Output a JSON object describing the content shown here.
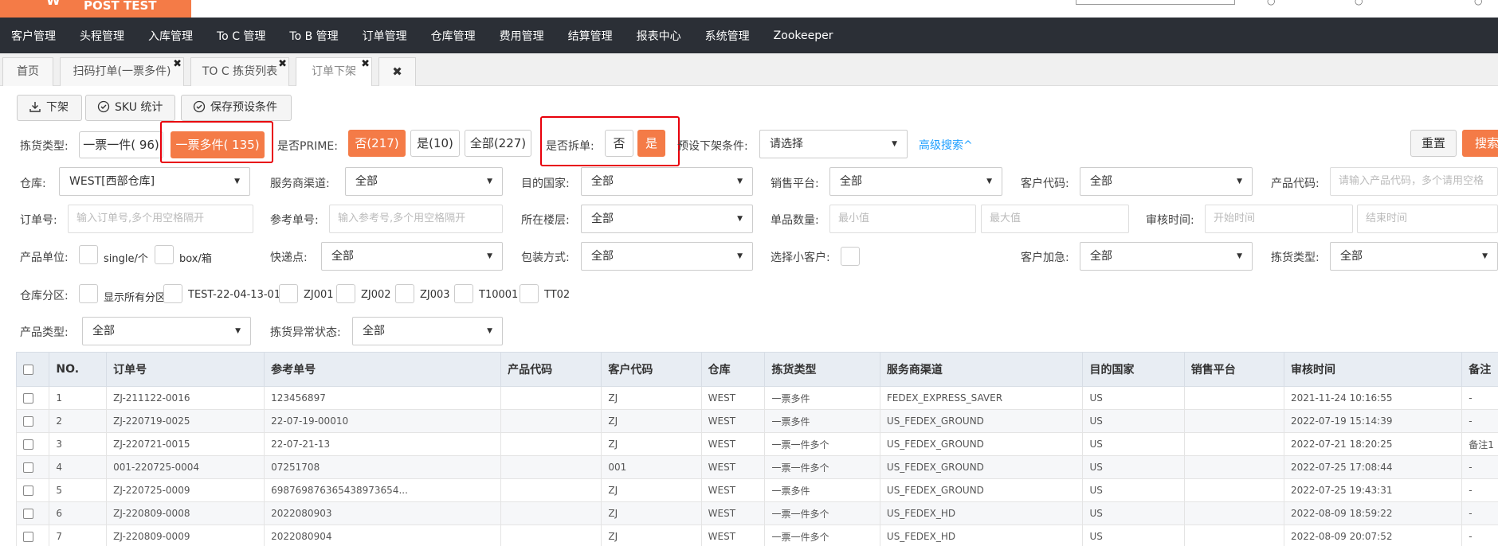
{
  "brand": {
    "logo_text": "POST TEST"
  },
  "nav": [
    "客户管理",
    "头程管理",
    "入库管理",
    "To C 管理",
    "To B 管理",
    "订单管理",
    "仓库管理",
    "费用管理",
    "结算管理",
    "报表中心",
    "系统管理",
    "Zookeeper"
  ],
  "tabs": [
    {
      "label": "首页"
    },
    {
      "label": "扫码打单(一票多件)"
    },
    {
      "label": "TO C 拣货列表"
    },
    {
      "label": "订单下架"
    }
  ],
  "toolbar": {
    "offshelf": "下架",
    "sku_stats": "SKU 统计",
    "save_preset": "保存预设条件"
  },
  "filters": {
    "pick_type_label": "拣货类型:",
    "pick_single": "一票一件( 96)",
    "pick_multi": "一票多件( 135)",
    "prime_label": "是否PRIME:",
    "prime_no": "否(217)",
    "prime_yes": "是(10)",
    "prime_all": "全部(227)",
    "split_label": "是否拆单:",
    "split_no": "否",
    "split_yes": "是",
    "preset_label": "预设下架条件:",
    "preset_value": "请选择",
    "advanced": "高级搜索^",
    "reset": "重置",
    "search": "搜索",
    "warehouse_label": "仓库:",
    "warehouse_value": "WEST[西部仓库]",
    "channel_label": "服务商渠道:",
    "channel_value": "全部",
    "dest_label": "目的国家:",
    "dest_value": "全部",
    "platform_label": "销售平台:",
    "platform_value": "全部",
    "customer_label": "客户代码:",
    "customer_value": "全部",
    "product_code_label": "产品代码:",
    "product_code_placeholder": "请输入产品代码，多个请用空格",
    "order_no_label": "订单号:",
    "order_no_placeholder": "输入订单号,多个用空格隔开",
    "ref_no_label": "参考单号:",
    "ref_no_placeholder": "输入参考号,多个用空格隔开",
    "floor_label": "所在楼层:",
    "floor_value": "全部",
    "qty_label": "单品数量:",
    "qty_min": "最小值",
    "qty_max": "最大值",
    "audit_label": "审核时间:",
    "audit_start": "开始时间",
    "audit_end": "结束时间",
    "unit_label": "产品单位:",
    "unit_single": "single/个",
    "unit_box": "box/箱",
    "express_label": "快递点:",
    "express_value": "全部",
    "pack_label": "包装方式:",
    "pack_value": "全部",
    "small_cust_label": "选择小客户:",
    "urgent_label": "客户加急:",
    "urgent_value": "全部",
    "pick_type2_label": "拣货类型:",
    "pick_type2_value": "全部",
    "zone_label": "仓库分区:",
    "zones": [
      "显示所有分区",
      "TEST-22-04-13-01",
      "ZJ001",
      "ZJ002",
      "ZJ003",
      "T10001",
      "TT02"
    ],
    "ptype_label": "产品类型:",
    "ptype_value": "全部",
    "exception_label": "拣货异常状态:",
    "exception_value": "全部"
  },
  "table": {
    "headers": [
      "NO.",
      "订单号",
      "参考单号",
      "产品代码",
      "客户代码",
      "仓库",
      "拣货类型",
      "服务商渠道",
      "目的国家",
      "销售平台",
      "审核时间",
      "备注"
    ],
    "rows": [
      [
        "1",
        "ZJ-211122-0016",
        "123456897",
        "",
        "ZJ",
        "WEST",
        "一票多件",
        "FEDEX_EXPRESS_SAVER",
        "US",
        "",
        "2021-11-24 10:16:55",
        "-"
      ],
      [
        "2",
        "ZJ-220719-0025",
        "22-07-19-00010",
        "",
        "ZJ",
        "WEST",
        "一票多件",
        "US_FEDEX_GROUND",
        "US",
        "",
        "2022-07-19 15:14:39",
        "-"
      ],
      [
        "3",
        "ZJ-220721-0015",
        "22-07-21-13",
        "",
        "ZJ",
        "WEST",
        "一票一件多个",
        "US_FEDEX_GROUND",
        "US",
        "",
        "2022-07-21 18:20:25",
        "备注1"
      ],
      [
        "4",
        "001-220725-0004",
        "07251708",
        "",
        "001",
        "WEST",
        "一票一件多个",
        "US_FEDEX_GROUND",
        "US",
        "",
        "2022-07-25 17:08:44",
        "-"
      ],
      [
        "5",
        "ZJ-220725-0009",
        "698769876365438973654...",
        "",
        "ZJ",
        "WEST",
        "一票多件",
        "US_FEDEX_GROUND",
        "US",
        "",
        "2022-07-25 19:43:31",
        "-"
      ],
      [
        "6",
        "ZJ-220809-0008",
        "2022080903",
        "",
        "ZJ",
        "WEST",
        "一票一件多个",
        "US_FEDEX_HD",
        "US",
        "",
        "2022-08-09 18:59:22",
        "-"
      ],
      [
        "7",
        "ZJ-220809-0009",
        "2022080904",
        "",
        "ZJ",
        "WEST",
        "一票一件多个",
        "US_FEDEX_HD",
        "US",
        "",
        "2022-08-09 20:07:52",
        "-"
      ]
    ]
  }
}
